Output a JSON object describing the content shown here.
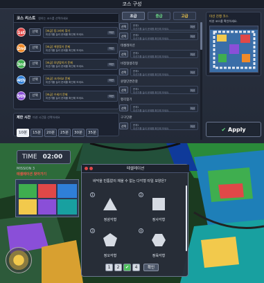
{
  "top_title": "코스 구성",
  "course_list": {
    "title": "코스 리스트",
    "hint": "원하는 코스를 선택하세요",
    "items": [
      {
        "num": "1st",
        "color": "#e04848",
        "select": "선택",
        "title": "[초급] 동그라미 찾기",
        "desc": "미션가를 눌러 문제를 확인해 보세요.",
        "tag": "미션"
      },
      {
        "num": "2nd",
        "color": "#f08a2a",
        "select": "선택",
        "title": "[초급] 색깔찾기 문제",
        "desc": "미션가를 눌러 문제를 확인해 보세요.",
        "tag": "미션"
      },
      {
        "num": "3rd",
        "color": "#3fae4f",
        "select": "선택",
        "title": "[초급] 모양맞히기 문제",
        "desc": "미션가를 눌러 문제를 확인해 보세요.",
        "tag": "미션"
      },
      {
        "num": "4th",
        "color": "#2f7fd8",
        "select": "선택",
        "title": "[초급] 크기비교 문제",
        "desc": "미션가를 눌러 문제를 확인해 보세요.",
        "tag": "미션"
      },
      {
        "num": "5th",
        "color": "#8a4fd8",
        "select": "선택",
        "title": "[초급] 수세기 문제",
        "desc": "미션가를 눌러 문제를 확인해 보세요.",
        "tag": "미션"
      }
    ]
  },
  "time_panel": {
    "title": "제한 시간",
    "hint": "미션 시간을 선택하세요",
    "options": [
      "10분",
      "15분",
      "20분",
      "25분",
      "30분",
      "35분"
    ],
    "selected_index": 0
  },
  "tabs": [
    "초급",
    "중급",
    "고급"
  ],
  "mission_list": {
    "sections": [
      {
        "category": "",
        "items": [
          {
            "select": "선택",
            "title": "문제1",
            "desc": "미션가를 눌러 문제를 확인해 보세요.",
            "tag": "미션"
          },
          {
            "select": "선택",
            "title": "문제2",
            "desc": "미션가를 눌러 문제를 확인해 보세요.",
            "tag": "미션"
          }
        ]
      },
      {
        "category": "테셀레이션",
        "items": [
          {
            "select": "선택",
            "title": "문제1",
            "desc": "미션가를 눌러 문제를 확인해 보세요.",
            "tag": "미션"
          }
        ]
      },
      {
        "category": "비정형생각형",
        "items": [
          {
            "select": "선택",
            "title": "문제1",
            "desc": "미션가를 눌러 문제를 확인해 보세요.",
            "tag": "미션"
          }
        ]
      },
      {
        "category": "원형단면관찰",
        "items": [
          {
            "select": "선택",
            "title": "문제1",
            "desc": "미션가를 눌러 문제를 확인해 보세요.",
            "tag": "미션"
          }
        ]
      },
      {
        "category": "평각찾기",
        "items": [
          {
            "select": "선택",
            "title": "문제1",
            "desc": "미션가를 눌러 문제를 확인해 보세요.",
            "tag": "미션"
          }
        ]
      },
      {
        "category": "구구단판",
        "items": [
          {
            "select": "선택",
            "title": "문제1",
            "desc": "미션가를 눌러 문제를 확인해 보세요.",
            "tag": "미션"
          }
        ]
      }
    ]
  },
  "preview": {
    "title": "미션 진행 코스",
    "subtitle": "미션 코스를 확인하세요."
  },
  "apply_label": "Apply",
  "hud": {
    "time_label": "TIME",
    "time_value": "02:00",
    "mission_label": "MISSION 3",
    "mission_text": "테셀레이션 찾아가기"
  },
  "quiz": {
    "title": "테셀레이션",
    "question": "바닥을 빈틈없이 채울 수 없는 다각형 타일 모양은?",
    "options": [
      {
        "num": "1",
        "shape": "triangle-icon",
        "label": "정삼각형"
      },
      {
        "num": "2",
        "shape": "square-icon",
        "label": "정사각형"
      },
      {
        "num": "3",
        "shape": "pentagon-icon",
        "label": "정오각형"
      },
      {
        "num": "4",
        "shape": "hexagon-icon",
        "label": "정육각형"
      }
    ],
    "pages": [
      "1",
      "2",
      "3",
      "4"
    ],
    "active_page_index": 2,
    "confirm_label": "확인"
  },
  "colors": {
    "accent_green": "#4fbf5e",
    "accent_yellow": "#f2c94c",
    "danger_red": "#e04848"
  }
}
